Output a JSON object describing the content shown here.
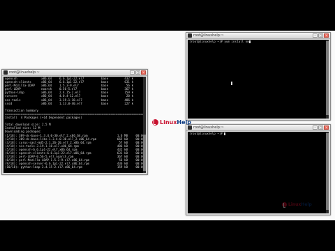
{
  "brand": {
    "name_a": "Linux",
    "name_b": "Help",
    "red": "#c8102e",
    "blue": "#0b3a82"
  },
  "left_window": {
    "title": "root@linuxhelp:~",
    "packages": [
      [
        "openssh",
        "x86_64",
        "6.6.1p1-22.el7",
        "base",
        "432 k"
      ],
      [
        "openssh-clients",
        "x86_64",
        "6.6.1p1-22.el7",
        "base",
        "631 k"
      ],
      [
        "perl-Mozilla-LDAP",
        "x86_64",
        "1.5.3-9.el7",
        "base",
        "56 k"
      ],
      [
        "perl-LDAP",
        "noarch",
        "0.56-5.el7",
        "base",
        "367 k"
      ],
      [
        "python-ldap",
        "x86_64",
        "2.4.15-2.el7",
        "base",
        "159 k"
      ],
      [
        "svrcore",
        "x86_64",
        "4.0.4-12.el7",
        "base",
        "20 k"
      ],
      [
        "nss-tools",
        "x86_64",
        "3.19.1-18.el7",
        "base",
        "486 k"
      ],
      [
        "sssd",
        "x86_64",
        "1.13.0-40.el7",
        "base",
        "227 k"
      ]
    ],
    "summary_heading": "Transaction Summary",
    "summary_rule": "================================================================================",
    "install_line": "Install  4 Packages (+14 Dependent packages)",
    "total_size": "Total download size: 2.5 M",
    "installed_size": "Installed size: 12 M",
    "downloading": "Downloading packages:",
    "downloads": [
      [
        "(1/18): 389-ds-base-1.3.4.0-30.el7_2.x86_64.rpm",
        "1.6 MB",
        "00:00"
      ],
      [
        "(2/18): 389-ds-base-libs-1.3.4.0-30.el7_2.x86_64.rpm",
        "665 kB",
        "00:00"
      ],
      [
        "(3/18): cyrus-sasl-md5-2.1.26-20.el7_2.x86_64.rpm",
        "57 kB",
        "00:00"
      ],
      [
        "(4/18): nss-tools-3.19.1-18.el7.x86_64.rpm",
        "486 kB",
        "00:00"
      ],
      [
        "(5/18): openssh-6.6.1p1-22.el7.x86_64.rpm",
        "432 kB",
        "00:00"
      ],
      [
        "(6/18): openssh-clients-6.6.1p1-22.el7.x86_64.rpm",
        "631 kB",
        "00:00"
      ],
      [
        "(7/18): perl-LDAP-0.56-5.el7.noarch.rpm",
        "367 kB",
        "00:00"
      ],
      [
        "(8/18): perl-Mozilla-LDAP-1.5.3-9.el7.x86_64.rpm",
        "56 kB",
        "00:00"
      ],
      [
        "(9/18): openssh-server-6.6.1p1-22.el7.x86_64.rpm",
        "436 kB",
        "00:00"
      ],
      [
        "(10/18): python-ldap-2.4.15-2.el7.x86_64.rpm",
        "159 kB",
        "00:00"
      ]
    ]
  },
  "top_right_window": {
    "title": "root@linuxhelp:~",
    "prompt": "[root@linuxhelp ~]# yum install nm"
  },
  "bottom_right_window": {
    "title": "root@linuxhelp:~",
    "prompt": "[root@linuxhelp ~]# "
  }
}
